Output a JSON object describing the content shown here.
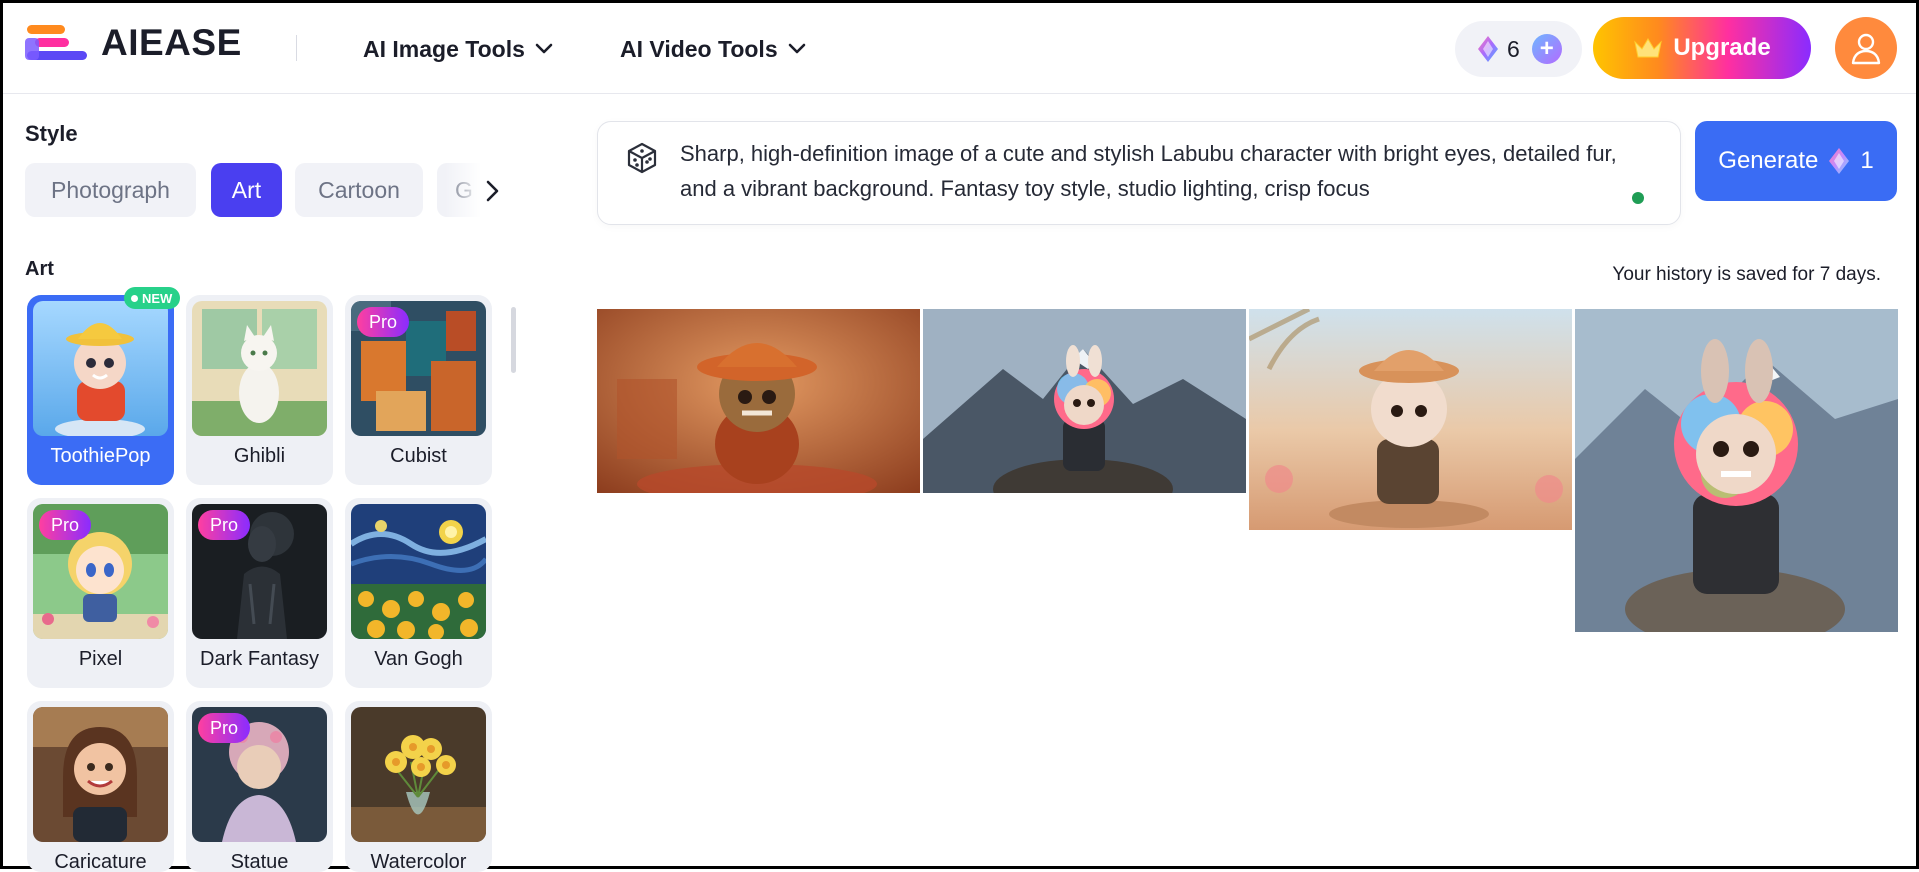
{
  "header": {
    "logo_text": "AIEASE",
    "nav": [
      {
        "label": "AI Image Tools"
      },
      {
        "label": "AI Video Tools"
      }
    ],
    "credits": "6",
    "upgrade_label": "Upgrade"
  },
  "sidebar": {
    "style_title": "Style",
    "tabs": [
      {
        "label": "Photograph",
        "active": false
      },
      {
        "label": "Art",
        "active": true
      },
      {
        "label": "Cartoon",
        "active": false
      },
      {
        "label": "G",
        "active": false
      }
    ],
    "section_title": "Art",
    "new_badge": "NEW",
    "pro_label": "Pro",
    "styles": [
      {
        "label": "ToothiePop",
        "selected": true,
        "pro": false
      },
      {
        "label": "Ghibli",
        "selected": false,
        "pro": false
      },
      {
        "label": "Cubist",
        "selected": false,
        "pro": true
      },
      {
        "label": "Pixel",
        "selected": false,
        "pro": true
      },
      {
        "label": "Dark Fantasy",
        "selected": false,
        "pro": true
      },
      {
        "label": "Van Gogh",
        "selected": false,
        "pro": false
      },
      {
        "label": "Caricature",
        "selected": false,
        "pro": false
      },
      {
        "label": "Statue",
        "selected": false,
        "pro": true
      },
      {
        "label": "Watercolor",
        "selected": false,
        "pro": false
      }
    ]
  },
  "prompt": {
    "text": "Sharp, high-definition image of a cute and stylish Labubu character with bright eyes, detailed fur, and a vibrant background. Fantasy toy style, studio lighting, crisp focus"
  },
  "generate": {
    "label": "Generate",
    "cost": "1"
  },
  "history_note": "Your history is saved for 7 days.",
  "colors": {
    "accent": "#3a6cf4",
    "tab_active": "#4a3ff0",
    "avatar": "#ff8a3d",
    "new_badge": "#27d18a"
  }
}
